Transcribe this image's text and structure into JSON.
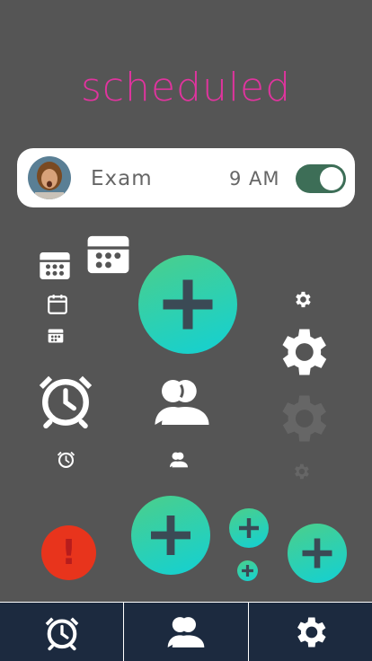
{
  "colors": {
    "background": "#555555",
    "title": "#e0349e",
    "toggle_on": "#3d6e57",
    "alert": "#e8341c",
    "tab_bar": "#1c2a3f",
    "fab_gradient_start": "#4ccf8a",
    "fab_gradient_end": "#12d0d4",
    "faded_gear": "#666666"
  },
  "header": {
    "title": "scheduled"
  },
  "event_card": {
    "title": "Exam",
    "time": "9 AM",
    "toggle_on": true,
    "avatar_icon": "person-avatar"
  },
  "icons": {
    "calendar": "calendar-icon",
    "alarm": "alarm-clock-icon",
    "people": "people-icon",
    "settings": "gear-icon",
    "add": "plus-icon",
    "alert": "exclamation-icon"
  },
  "alert_button": {
    "label": "!"
  },
  "tabs": [
    {
      "icon": "alarm-clock-icon"
    },
    {
      "icon": "people-icon"
    },
    {
      "icon": "gear-icon"
    }
  ]
}
